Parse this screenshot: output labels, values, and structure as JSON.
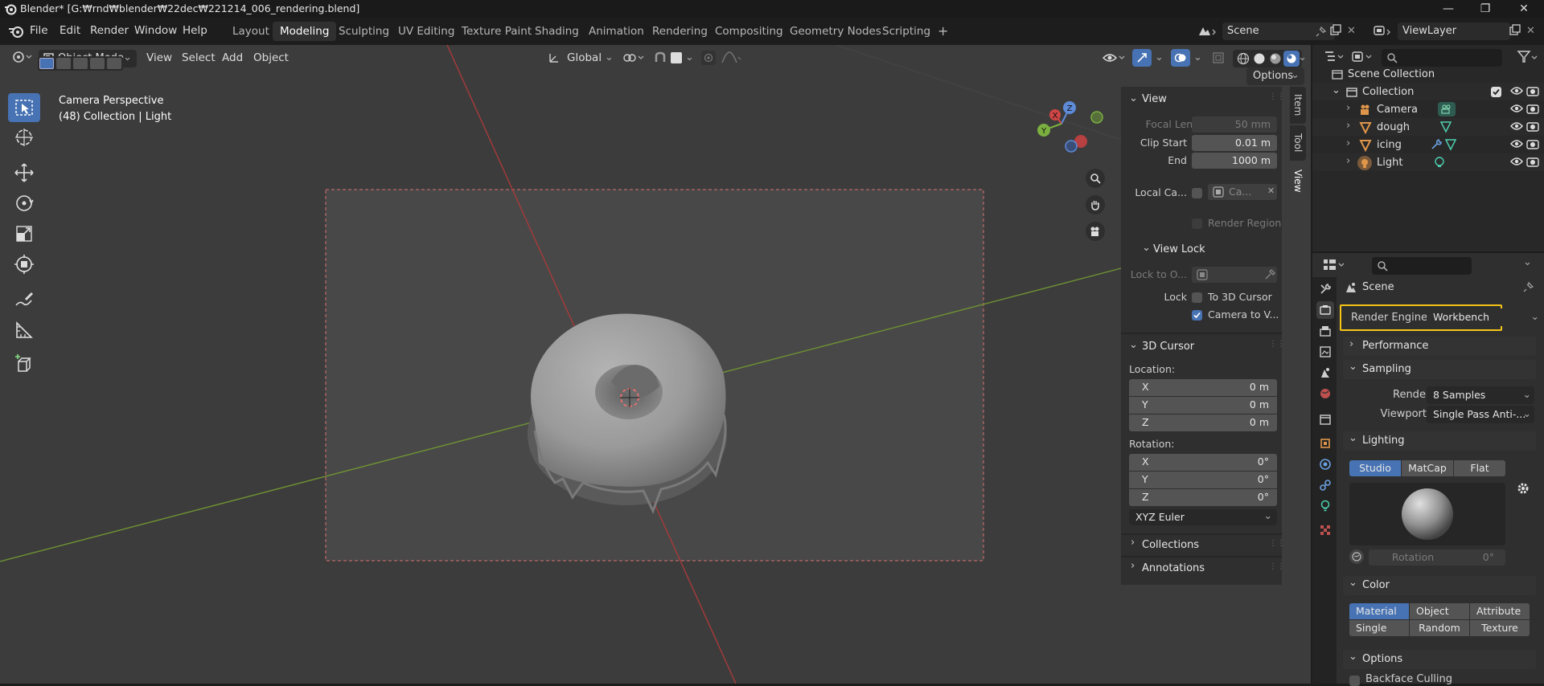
{
  "window": {
    "title": "Blender* [G:₩rnd₩blender₩22dec₩221214_006_rendering.blend]",
    "minimize": "—",
    "maximize": "❐",
    "close": "✕"
  },
  "menu": [
    "File",
    "Edit",
    "Render",
    "Window",
    "Help"
  ],
  "workspaces": [
    "Layout",
    "Modeling",
    "Sculpting",
    "UV Editing",
    "Texture Paint",
    "Shading",
    "Animation",
    "Rendering",
    "Compositing",
    "Geometry Nodes",
    "Scripting"
  ],
  "active_workspace": "Modeling",
  "add_workspace": "+",
  "scene": "Scene",
  "view_layer": "ViewLayer",
  "viewport": {
    "mode": "Object Mode",
    "menus": [
      "View",
      "Select",
      "Add",
      "Object"
    ],
    "orientation": "Global",
    "options": "Options",
    "info_line1": "Camera Perspective",
    "info_line2": "(48) Collection | Light",
    "gizmo": {
      "x": "X",
      "y": "Y",
      "z": "Z"
    }
  },
  "npanel": {
    "tabs": [
      "Item",
      "Tool",
      "View"
    ],
    "active_tab": "View",
    "view": {
      "title": "View",
      "focal_length_label": "Focal Length",
      "focal_length": "50 mm",
      "clip_start_label": "Clip Start",
      "clip_start": "0.01 m",
      "end_label": "End",
      "end": "1000 m",
      "local_camera_label": "Local Ca...",
      "local_camera_value": "Ca...",
      "render_region": "Render Region"
    },
    "view_lock": {
      "title": "View Lock",
      "lock_to_label": "Lock to O...",
      "lock_label": "Lock",
      "to_3d_cursor": "To 3D Cursor",
      "camera_to_view": "Camera to V..."
    },
    "cursor": {
      "title": "3D Cursor",
      "location_label": "Location:",
      "loc": [
        {
          "axis": "X",
          "value": "0 m"
        },
        {
          "axis": "Y",
          "value": "0 m"
        },
        {
          "axis": "Z",
          "value": "0 m"
        }
      ],
      "rotation_label": "Rotation:",
      "rot": [
        {
          "axis": "X",
          "value": "0°"
        },
        {
          "axis": "Y",
          "value": "0°"
        },
        {
          "axis": "Z",
          "value": "0°"
        }
      ],
      "rotation_mode": "XYZ Euler"
    },
    "collections": "Collections",
    "annotations": "Annotations"
  },
  "outliner": {
    "root": "Scene Collection",
    "collection": "Collection",
    "items": [
      "Camera",
      "dough",
      "icing",
      "Light"
    ]
  },
  "properties": {
    "context": "Scene",
    "render_engine_label": "Render Engine",
    "render_engine": "Workbench",
    "performance": "Performance",
    "sampling": "Sampling",
    "render_label": "Render",
    "render_samples": "8 Samples",
    "viewport_label": "Viewport",
    "viewport_samples": "Single Pass Anti-...",
    "lighting": "Lighting",
    "lighting_modes": [
      "Studio",
      "MatCap",
      "Flat"
    ],
    "lighting_active": "Studio",
    "rotation_label": "Rotation",
    "rotation_value": "0°",
    "color": "Color",
    "color_modes_row1": [
      "Material",
      "Object",
      "Attribute"
    ],
    "color_modes_row2": [
      "Single",
      "Random",
      "Texture"
    ],
    "color_active": "Material",
    "options": "Options",
    "backface_culling": "Backface Culling"
  },
  "colors": {
    "accent_blue": "#4772b3",
    "highlight_box": "#f5c518",
    "x_axis": "#e05050",
    "y_axis": "#78b83c"
  }
}
